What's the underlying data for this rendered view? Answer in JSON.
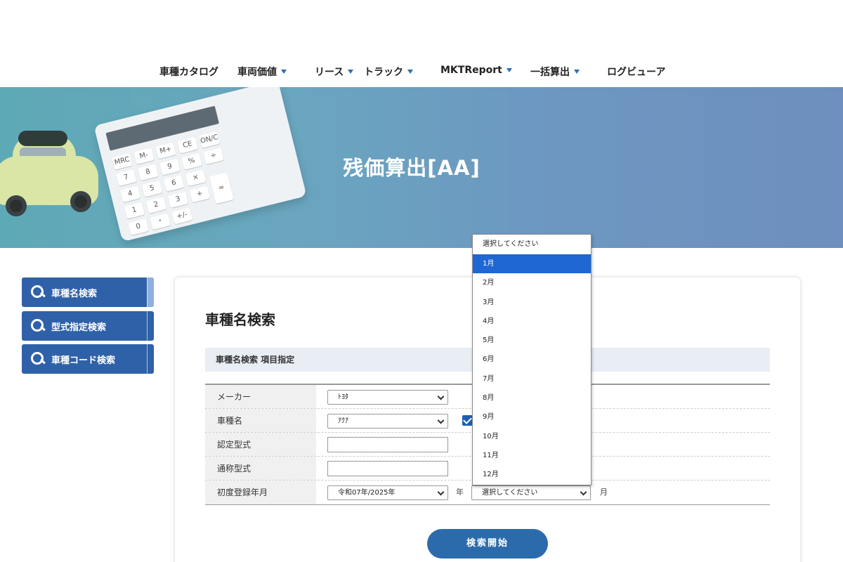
{
  "nav": {
    "items": [
      {
        "label": "車種カタログ",
        "dropdown": false
      },
      {
        "label": "車両価値",
        "dropdown": true
      },
      {
        "label": "リース",
        "dropdown": true
      },
      {
        "label": "トラック",
        "dropdown": true
      },
      {
        "label": "MKTReport",
        "dropdown": true
      },
      {
        "label": "一括算出",
        "dropdown": true
      },
      {
        "label": "ログビューア",
        "dropdown": false
      }
    ]
  },
  "hero": {
    "title": "残価算出[AA]",
    "calculator_keys": [
      "MRC",
      "M-",
      "M+",
      "CE",
      "ON/C",
      "7",
      "8",
      "9",
      "%",
      "÷",
      "4",
      "5",
      "6",
      "×",
      "1",
      "2",
      "3",
      "+",
      "0",
      "・",
      "+/-",
      "="
    ]
  },
  "sidebar": {
    "items": [
      {
        "label": "車種名検索",
        "active": true
      },
      {
        "label": "型式指定検索",
        "active": false
      },
      {
        "label": "車種コード検索",
        "active": false
      }
    ]
  },
  "panel": {
    "title": "車種名検索",
    "section_label": "車種名検索 項目指定",
    "rows": {
      "maker": {
        "label": "メーカー",
        "value": "ﾄﾖﾀ"
      },
      "model": {
        "label": "車種名",
        "value": "ｱｸｱ",
        "checkbox_checked": true
      },
      "certified_type": {
        "label": "認定型式",
        "value": ""
      },
      "common_type": {
        "label": "通称型式",
        "value": ""
      },
      "first_registration": {
        "label": "初度登録年月",
        "year_value": "令和07年/2025年",
        "year_unit": "年",
        "month_value": "選択してください",
        "month_unit": "月"
      }
    },
    "search_button": "検索開始"
  },
  "month_dropdown": {
    "options": [
      "選択してください",
      "1月",
      "2月",
      "3月",
      "4月",
      "5月",
      "6月",
      "7月",
      "8月",
      "9月",
      "10月",
      "11月",
      "12月"
    ],
    "highlighted": "1月"
  },
  "colors": {
    "primary": "#2f61a8",
    "highlight": "#1f67d2",
    "section_bg": "#e9eef5"
  }
}
